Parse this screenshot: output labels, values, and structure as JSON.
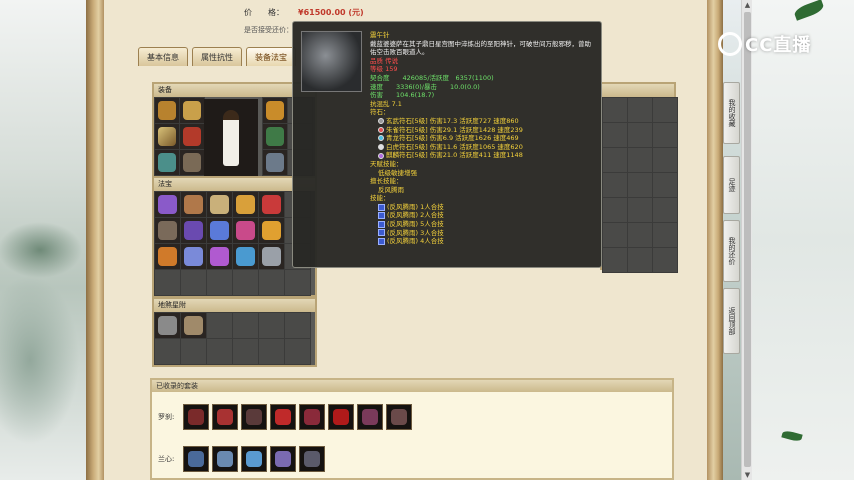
{
  "header": {
    "price_label": "价　　格：",
    "price_value": "¥61500.00 (元)",
    "bind_label": "是否接受还价："
  },
  "tabs": [
    {
      "label": "基本信息"
    },
    {
      "label": "属性抗性"
    },
    {
      "label": "装备法宝"
    }
  ],
  "equipment_panel": {
    "title": "装备"
  },
  "fabao_panel": {
    "title": "法宝"
  },
  "mount_panel": {
    "title": "地煞星附"
  },
  "suit_panel": {
    "title": "已收录的套装",
    "rows": [
      {
        "label": "罗刹:"
      },
      {
        "label": "兰心:"
      }
    ]
  },
  "tooltip": {
    "name": "震午针",
    "desc": "戴蓝婆婆萨在其子鼎日星宫图中淬炼出的至阳神针，可破世间万般邪秽，曾助佑空击败百眼道人。",
    "tag1": "品质 传说",
    "tag2": "等级 159",
    "stat1": "契合度　　426085/活跃度　6357(1100)",
    "stat2": "速度　　3336(0)/暴击　　10.0(0.0)",
    "stat3": "伤害　　104.6(18.7)",
    "stat4": "抗混乱 7.1",
    "runes_title": "符石：",
    "runes": [
      {
        "text": "玄武符石[5级] 伤害17.3 活跃度727 速度860",
        "color": "#d8d8d8"
      },
      {
        "text": "朱雀符石[5级] 伤害29.1 活跃度1428 速度239",
        "color": "#e05050"
      },
      {
        "text": "青龙符石[5级] 伤害6.9 活跃度1626 速度469",
        "color": "#4fc0e0"
      },
      {
        "text": "白虎符石[5级] 伤害11.6 活跃度1065 速度620",
        "color": "#e0e0e0"
      },
      {
        "text": "麒麟符石[5级] 伤害21.0 活跃度411 速度1148",
        "color": "#b06ae0"
      }
    ],
    "talent_title": "天赋技能：",
    "talent_value": "低级敏捷增强",
    "special_title": "擅长技能：",
    "special_value": "反风腾雨",
    "skills_title": "技能：",
    "skills": [
      {
        "text": "(反风腾雨) 1人合技"
      },
      {
        "text": "(反风腾雨) 2人合技"
      },
      {
        "text": "(反风腾雨) 5人合技"
      },
      {
        "text": "(反风腾雨) 3人合技"
      },
      {
        "text": "(反风腾雨) 4人合技"
      }
    ]
  },
  "side_nav": [
    {
      "label": "我的收藏"
    },
    {
      "label": "足迹"
    },
    {
      "label": "我的还价"
    },
    {
      "label": "返回顶部"
    }
  ],
  "logo": {
    "text": "CC直播"
  },
  "colors": {
    "accent": "#c0392b",
    "panel_border": "#b9a476",
    "tooltip_bg": "#282824",
    "highlight_yellow": "#f4d23b",
    "highlight_green": "#6ee26a"
  },
  "icons": [
    "chevron-up-icon",
    "chevron-down-icon",
    "rune-icon",
    "skill-icon",
    "cc-logo-icon"
  ]
}
